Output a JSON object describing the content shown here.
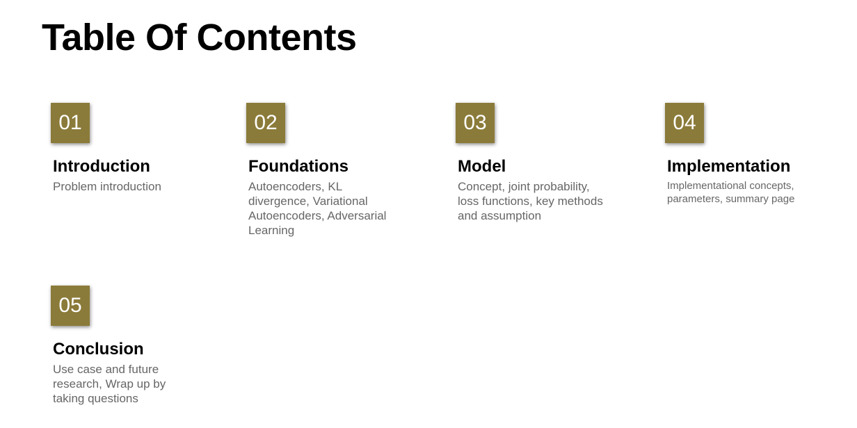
{
  "title": "Table Of Contents",
  "items": [
    {
      "number": "01",
      "heading": "Introduction",
      "description": "Problem introduction"
    },
    {
      "number": "02",
      "heading": "Foundations",
      "description": "Autoencoders, KL divergence, Variational Autoencoders, Adversarial Learning"
    },
    {
      "number": "03",
      "heading": "Model",
      "description": "Concept, joint probability, loss functions, key methods and assumption"
    },
    {
      "number": "04",
      "heading": "Implementation",
      "description": "Implementational concepts, parameters, summary page"
    },
    {
      "number": "05",
      "heading": "Conclusion",
      "description": "Use case and future research, Wrap up by taking questions"
    }
  ],
  "colors": {
    "accent": "#8b7b3a",
    "heading": "#000000",
    "description": "#666666"
  }
}
